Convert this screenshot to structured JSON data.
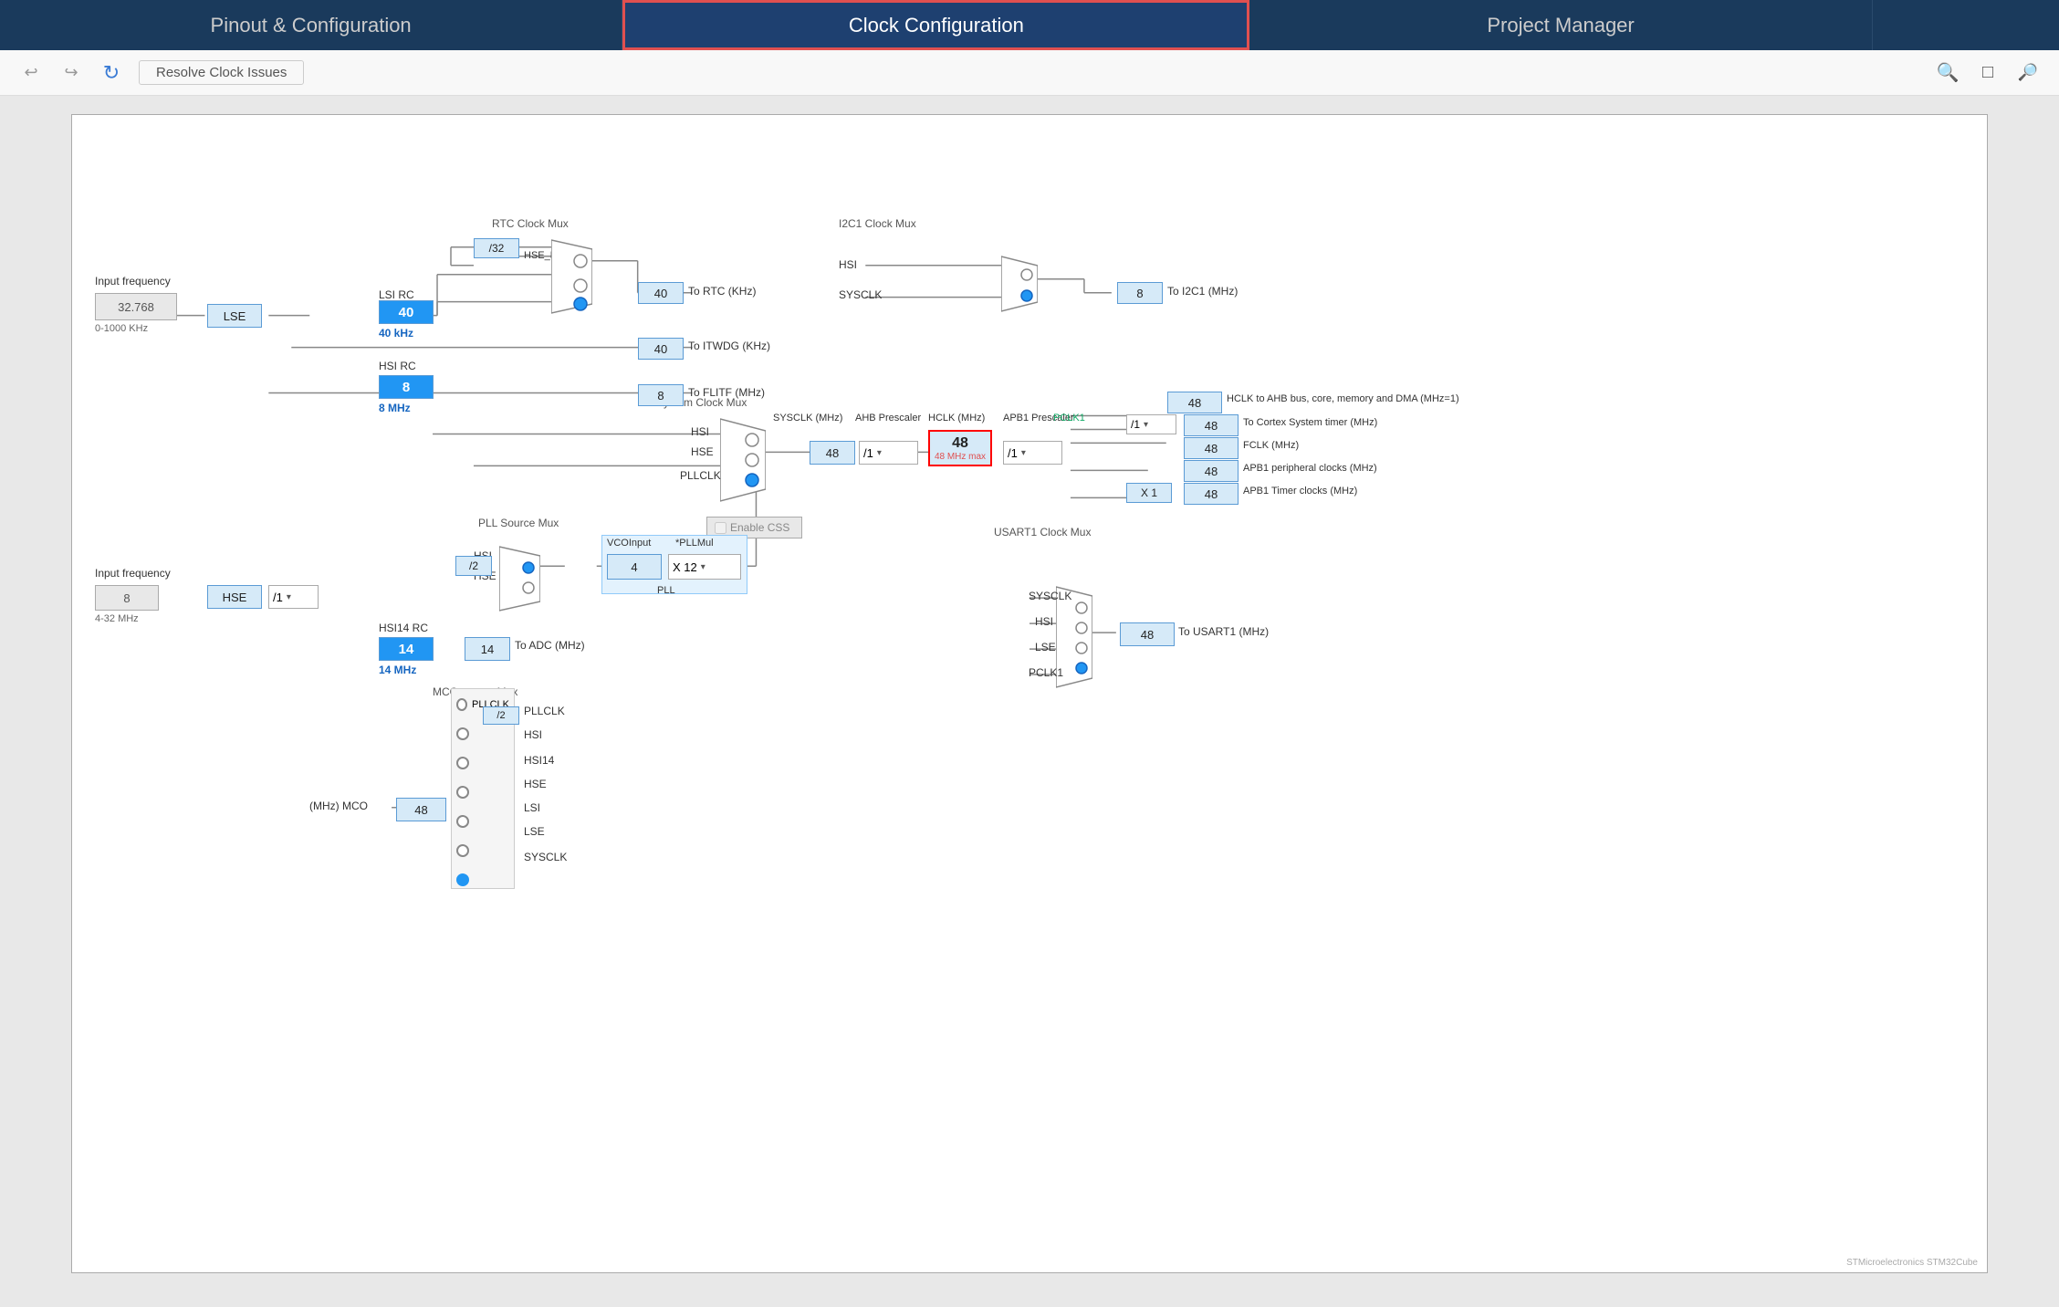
{
  "nav": {
    "items": [
      {
        "label": "Pinout & Configuration",
        "active": false
      },
      {
        "label": "Clock Configuration",
        "active": true
      },
      {
        "label": "Project Manager",
        "active": false
      },
      {
        "label": "",
        "active": false
      }
    ]
  },
  "toolbar": {
    "undo_label": "↩",
    "redo_label": "↪",
    "refresh_label": "↻",
    "resolve_label": "Resolve Clock Issues",
    "zoom_in_label": "🔍",
    "fit_label": "⛶",
    "zoom_out_label": "🔎"
  },
  "diagram": {
    "input_freq_1_label": "Input frequency",
    "input_freq_1_value": "32.768",
    "input_freq_1_range": "0-1000 KHz",
    "input_freq_2_label": "Input frequency",
    "input_freq_2_value": "8",
    "input_freq_2_range": "4-32 MHz",
    "lse_label": "LSE",
    "lsi_rc_label": "LSI RC",
    "lsi_rc_value": "40",
    "lsi_rc_freq": "40 kHz",
    "hsi_rc_label": "HSI RC",
    "hsi_rc_value": "8",
    "hsi_rc_freq": "8 MHz",
    "hsi14_rc_label": "HSI14 RC",
    "hsi14_rc_value": "14",
    "hsi14_rc_freq": "14 MHz",
    "hse_label": "HSE",
    "rtc_mux_title": "RTC Clock Mux",
    "i2c1_mux_title": "I2C1 Clock Mux",
    "system_clk_mux_title": "System Clock Mux",
    "pll_source_mux_title": "PLL Source Mux",
    "mco_source_mux_title": "MCO source Mux",
    "usart1_mux_title": "USART1 Clock Mux",
    "hse_rtc_label": "HSE_RTC",
    "div32_label": "/32",
    "to_rtc_label": "To RTC (KHz)",
    "to_iwdg_label": "To ITWDG (KHz)",
    "to_flitf_label": "To FLITF (MHz)",
    "to_i2c1_label": "To I2C1 (MHz)",
    "to_adc_label": "To ADC (MHz)",
    "to_usart1_label": "To USART1 (MHz)",
    "rtc_box_40": "40",
    "rtc_box_40b": "40",
    "flitf_value": "8",
    "i2c1_value": "8",
    "adc_value": "14",
    "usart1_value": "48",
    "sysclk_mhz_label": "SYSCLK (MHz)",
    "ahb_prescaler_label": "AHB Prescaler",
    "hclk_label": "HCLK (MHz)",
    "apb1_prescaler_label": "APB1 Prescaler",
    "pclk1_label": "PCLK1",
    "pclk1_max": "48 MHz max",
    "sysclk_48": "48",
    "hclk_48": "48",
    "ahb_div1": "/1",
    "apb1_div1": "/1",
    "hclk_to_ahb": "HCLK to AHB bus, core, memory and DMA (MHz=1)",
    "hclk_value_1": "48",
    "cortex_timer_label": "To Cortex System timer (MHz)",
    "cortex_timer_value": "48",
    "fclk_label": "FCLK (MHz)",
    "fclk_value": "48",
    "apb1_periph_label": "APB1 peripheral clocks (MHz)",
    "apb1_periph_value": "48",
    "apb1_timer_label": "APB1 Timer clocks (MHz)",
    "apb1_timer_value": "48",
    "x1_label": "X 1",
    "pll_div2": "/2",
    "pll_div1": "/1",
    "vco_input_label": "VCOInput",
    "pll_mul_label": "*PLLMul",
    "vco_value": "4",
    "pll_mul_value": "X 12",
    "pll_label": "PLL",
    "mco_value": "48",
    "mco_label": "(MHz) MCO",
    "mco_pllclk": "PLLCLK",
    "mco_hsi": "HSI",
    "mco_hsi14": "HSI14",
    "mco_hse": "HSE",
    "mco_lsi": "LSI",
    "mco_lse": "LSE",
    "mco_sysclk": "SYSCLK",
    "mco_div2": "/2",
    "enable_css": "Enable CSS",
    "hsi_label": "HSI",
    "hse_label2": "HSE",
    "pllclk_label": "PLLCLK",
    "sysclk_label": "SYSCLK",
    "hsi_label2": "HSI",
    "lse_label2": "LSE",
    "pclk1_label2": "PCLK1"
  }
}
